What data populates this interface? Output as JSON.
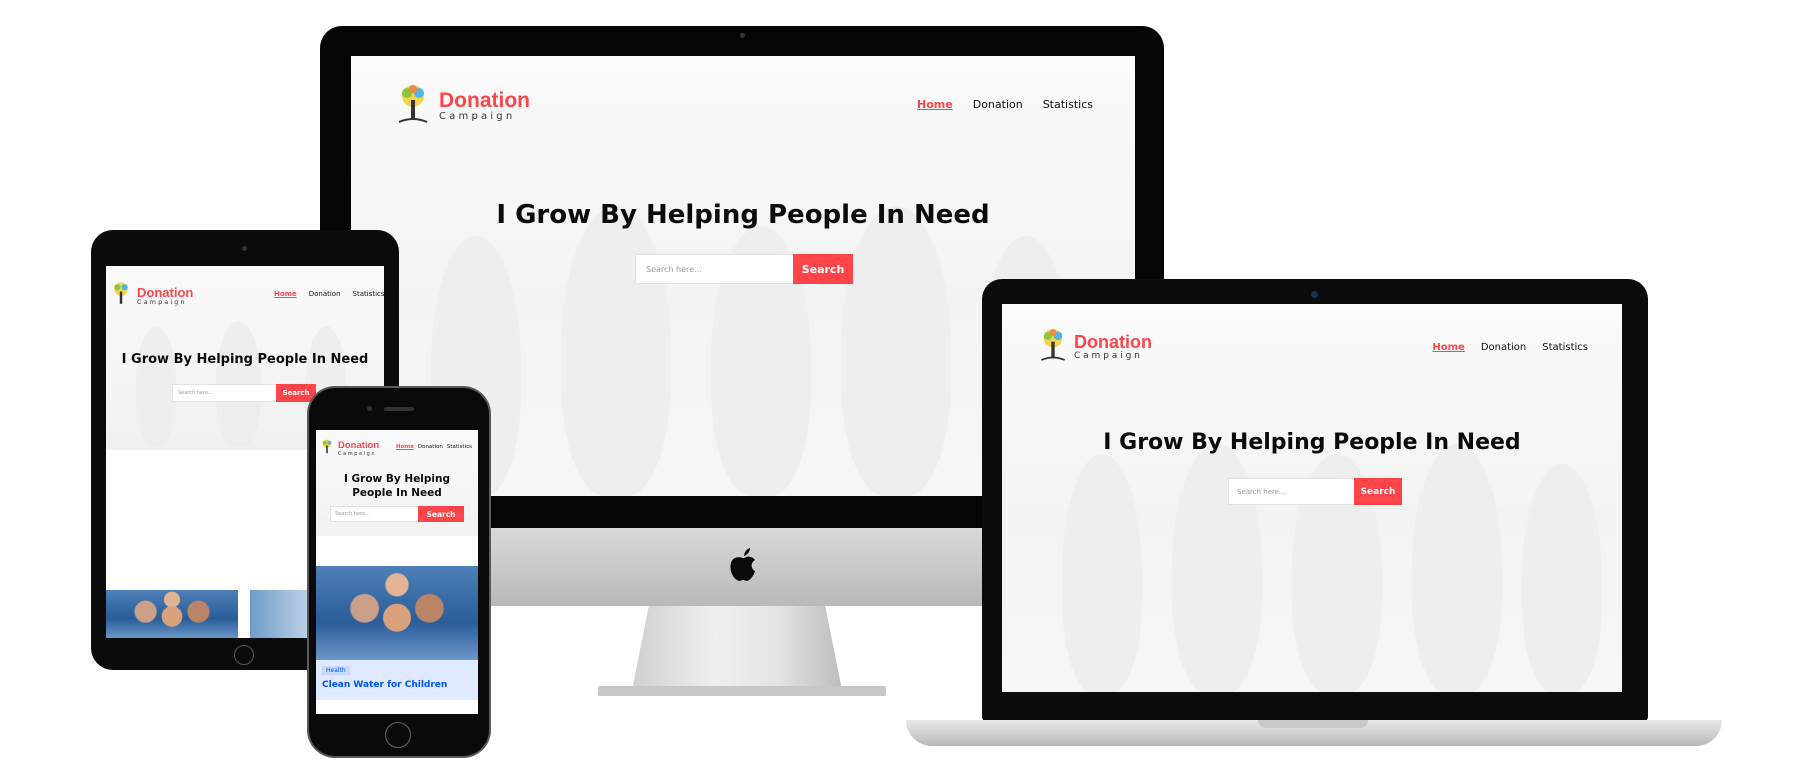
{
  "site": {
    "brand": "Donation",
    "brand_sub": "Campaign",
    "nav": [
      "Home",
      "Donation",
      "Statistics"
    ],
    "hero_title": "I Grow By Helping People In Need",
    "search_placeholder": "Search here...",
    "search_button": "Search"
  },
  "card": {
    "category": "Health",
    "title": "Clean Water for Children"
  },
  "colors": {
    "accent": "#ff444a",
    "card_bg": "#dfe9ff",
    "card_tag_bg": "#c9d9ff",
    "card_text": "#0052ff"
  }
}
